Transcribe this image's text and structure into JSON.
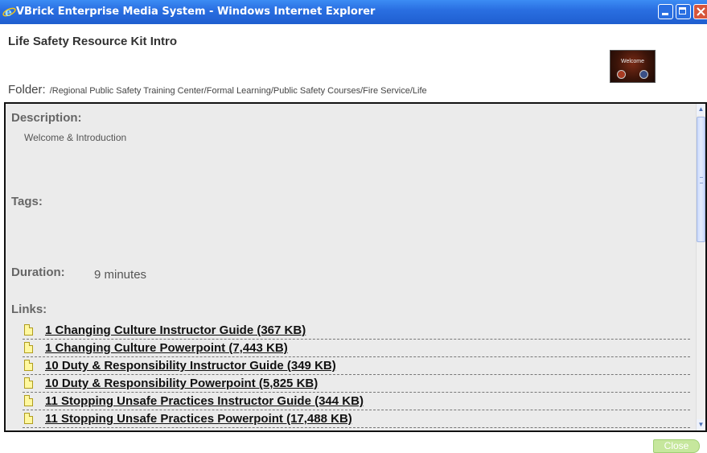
{
  "window": {
    "title": "VBrick Enterprise Media System - Windows Internet Explorer"
  },
  "page": {
    "title": "Life Safety Resource Kit Intro",
    "thumbnail_caption": "Welcome"
  },
  "folder": {
    "label": "Folder:",
    "path": "/Regional Public Safety Training Center/Formal Learning/Public Safety Courses/Fire Service/Life"
  },
  "details": {
    "description_label": "Description:",
    "description": "Welcome & Introduction",
    "tags_label": "Tags:",
    "duration_label": "Duration:",
    "duration": "9 minutes",
    "links_label": "Links:"
  },
  "links": [
    "1 Changing Culture Instructor Guide (367 KB)",
    "1 Changing Culture Powerpoint (7,443 KB)",
    "10 Duty & Responsibility Instructor Guide (349 KB)",
    "10 Duty & Responsibility Powerpoint (5,825 KB)",
    "11 Stopping Unsafe Practices Instructor Guide (344 KB)",
    "11 Stopping Unsafe Practices Powerpoint (17,488 KB)"
  ],
  "footer": {
    "close_label": "Close"
  },
  "colors": {
    "titlebar": "#2a6fe2",
    "panel_bg": "#ebebeb",
    "close_button": "#c6e79d"
  }
}
